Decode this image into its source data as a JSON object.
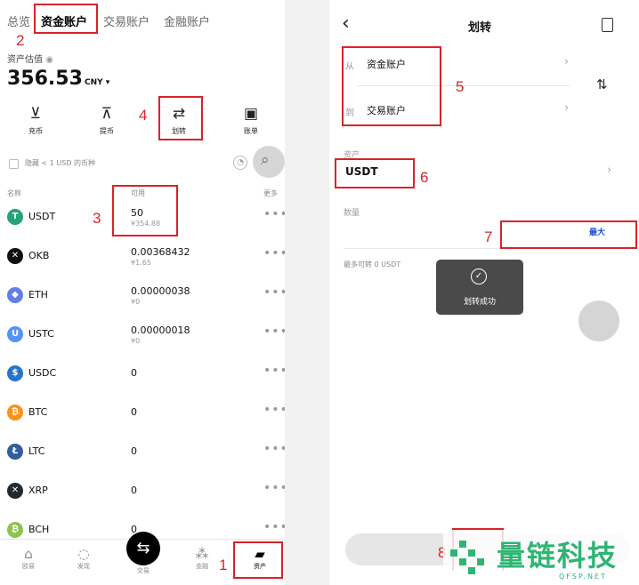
{
  "left": {
    "tabs": [
      "总览",
      "资金账户",
      "交易账户",
      "金融账户"
    ],
    "asset_label": "资产估值",
    "asset_value": "356.53",
    "currency": "CNY ▾",
    "actions": [
      {
        "label": "充币",
        "icon": "download-icon"
      },
      {
        "label": "提币",
        "icon": "upload-icon"
      },
      {
        "label": "划转",
        "icon": "transfer-icon"
      },
      {
        "label": "账单",
        "icon": "bill-icon"
      }
    ],
    "hide_small": "隐藏 < 1 USD 的币种",
    "col_name": "名称",
    "col_available": "可用",
    "col_more": "更多",
    "coins": [
      {
        "symbol": "USDT",
        "amount": "50",
        "sub": "¥354.88",
        "color": "#26a17b",
        "glyph": "T"
      },
      {
        "symbol": "OKB",
        "amount": "0.00368432",
        "sub": "¥1.65",
        "color": "#111111",
        "glyph": "✕"
      },
      {
        "symbol": "ETH",
        "amount": "0.00000038",
        "sub": "¥0",
        "color": "#627eea",
        "glyph": "◆"
      },
      {
        "symbol": "USTC",
        "amount": "0.00000018",
        "sub": "¥0",
        "color": "#5493f7",
        "glyph": "U"
      },
      {
        "symbol": "USDC",
        "amount": "0",
        "sub": "",
        "color": "#2775ca",
        "glyph": "$"
      },
      {
        "symbol": "BTC",
        "amount": "0",
        "sub": "",
        "color": "#f7931a",
        "glyph": "₿"
      },
      {
        "symbol": "LTC",
        "amount": "0",
        "sub": "",
        "color": "#345d9d",
        "glyph": "Ł"
      },
      {
        "symbol": "XRP",
        "amount": "0",
        "sub": "",
        "color": "#23292f",
        "glyph": "✕"
      },
      {
        "symbol": "BCH",
        "amount": "0",
        "sub": "",
        "color": "#8dc351",
        "glyph": "₿"
      }
    ],
    "more_dots": "•••",
    "nav": [
      {
        "label": "欧易",
        "icon": "home-icon"
      },
      {
        "label": "发现",
        "icon": "discover-icon"
      },
      {
        "label": "交易",
        "icon": "trade-icon"
      },
      {
        "label": "金融",
        "icon": "finance-icon"
      },
      {
        "label": "资产",
        "icon": "wallet-icon"
      }
    ]
  },
  "right": {
    "back": "‹",
    "title": "划转",
    "from_label": "从",
    "from_value": "资金账户",
    "to_label": "到",
    "to_value": "交易账户",
    "asset_label": "资产",
    "asset_value": "USDT",
    "qty_label": "数量",
    "max_label": "最大",
    "max_transfer": "最多可转 0 USDT",
    "toast": "划转成功"
  },
  "annotations": [
    "1",
    "2",
    "3",
    "4",
    "5",
    "6",
    "7",
    "8"
  ],
  "watermark": {
    "text": "量链科技",
    "site": "QFSP.NET"
  },
  "colors": {
    "annotation_red": "#d8232a",
    "max_blue": "#1f4fd6",
    "watermark_green": "#2fb573"
  }
}
